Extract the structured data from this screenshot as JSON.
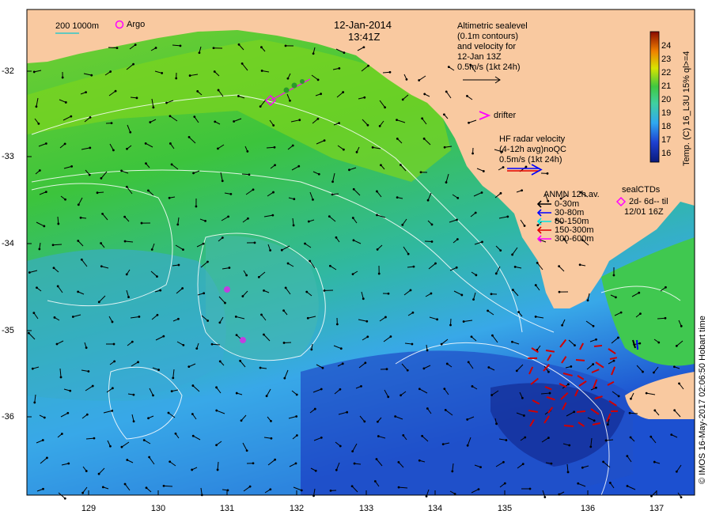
{
  "title": {
    "date": "12-Jan-2014",
    "time": "13:41Z"
  },
  "scale_bar": {
    "label": "200  1000m"
  },
  "argo": {
    "label": "Argo"
  },
  "altimetric": {
    "lines": [
      "Altimetric sealevel",
      "(0.1m contours)",
      "and velocity for",
      "12-Jan 13Z",
      "0.5m/s (1kt 24h)"
    ]
  },
  "drifter": {
    "label": "drifter"
  },
  "hf_radar": {
    "lines": [
      "HF radar velocity",
      "(4-12h avg)noQC",
      "0.5m/s (1kt 24h)"
    ]
  },
  "anmn": {
    "title": "ANMN 12h av.",
    "items": [
      {
        "label": "0-30m",
        "color": "#000000"
      },
      {
        "label": "30-80m",
        "color": "#0000ff"
      },
      {
        "label": "80-150m",
        "color": "#00e5e5"
      },
      {
        "label": "150-300m",
        "color": "#e00000"
      },
      {
        "label": "300-600m",
        "color": "#ff00ff"
      }
    ]
  },
  "sealctd": {
    "lines": [
      "sealCTDs",
      "2d- 6d-- til",
      "12/01 16Z"
    ]
  },
  "colorbar": {
    "ticks": [
      "24",
      "23",
      "22",
      "21",
      "20",
      "19",
      "18",
      "17",
      "16"
    ],
    "label": "Temp. (C) 16_L3U 15% ql>=4"
  },
  "credit": "© IMOS 16-May-2017 02:06:50 Hobart time",
  "y_ticks": [
    "-32",
    "-33",
    "-34",
    "-35",
    "-36"
  ],
  "x_ticks": [
    "129",
    "130",
    "131",
    "132",
    "133",
    "134",
    "135",
    "136",
    "137"
  ],
  "colors": {
    "land": "#f9c9a0",
    "warm": "#d9e600",
    "mid": "#3dc83d",
    "cool": "#3ab0e8",
    "cold": "#1840c8"
  }
}
